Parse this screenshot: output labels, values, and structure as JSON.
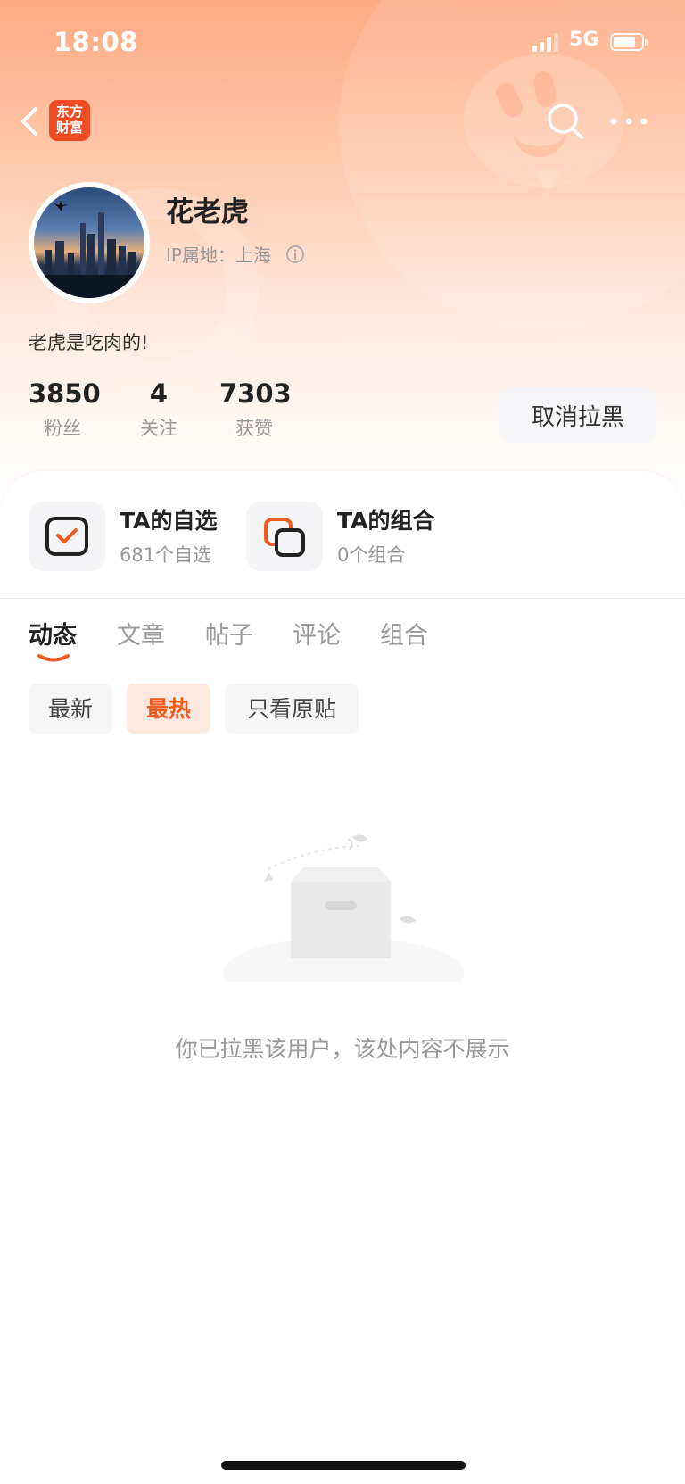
{
  "status_bar": {
    "time": "18:08",
    "network": "5G",
    "battery_icon": "battery-icon"
  },
  "nav": {
    "back_icon": "chevron-left-icon",
    "logo_line1": "东方",
    "logo_line2": "财富",
    "search_icon": "search-icon",
    "more_icon": "more-icon"
  },
  "profile": {
    "name": "花老虎",
    "ip_location": "IP属地：上海",
    "bio": "老虎是吃肉的!",
    "stats": [
      {
        "value": "3850",
        "label": "粉丝"
      },
      {
        "value": "4",
        "label": "关注"
      },
      {
        "value": "7303",
        "label": "获赞"
      }
    ],
    "unblock_label": "取消拉黑"
  },
  "features": [
    {
      "title": "TA的自选",
      "subtitle": "681个自选",
      "icon": "checklist-icon"
    },
    {
      "title": "TA的组合",
      "subtitle": "0个组合",
      "icon": "portfolio-icon"
    }
  ],
  "tabs": [
    {
      "label": "动态",
      "active": true
    },
    {
      "label": "文章",
      "active": false
    },
    {
      "label": "帖子",
      "active": false
    },
    {
      "label": "评论",
      "active": false
    },
    {
      "label": "组合",
      "active": false
    }
  ],
  "filters": [
    {
      "label": "最新",
      "active": false
    },
    {
      "label": "最热",
      "active": true
    },
    {
      "label": "只看原贴",
      "active": false
    }
  ],
  "empty_state": {
    "message": "你已拉黑该用户，该处内容不展示",
    "icon": "empty-box-icon"
  },
  "colors": {
    "accent": "#f05a1e",
    "header_gradient_top": "#ffa982",
    "logo_red": "#f04c24"
  }
}
